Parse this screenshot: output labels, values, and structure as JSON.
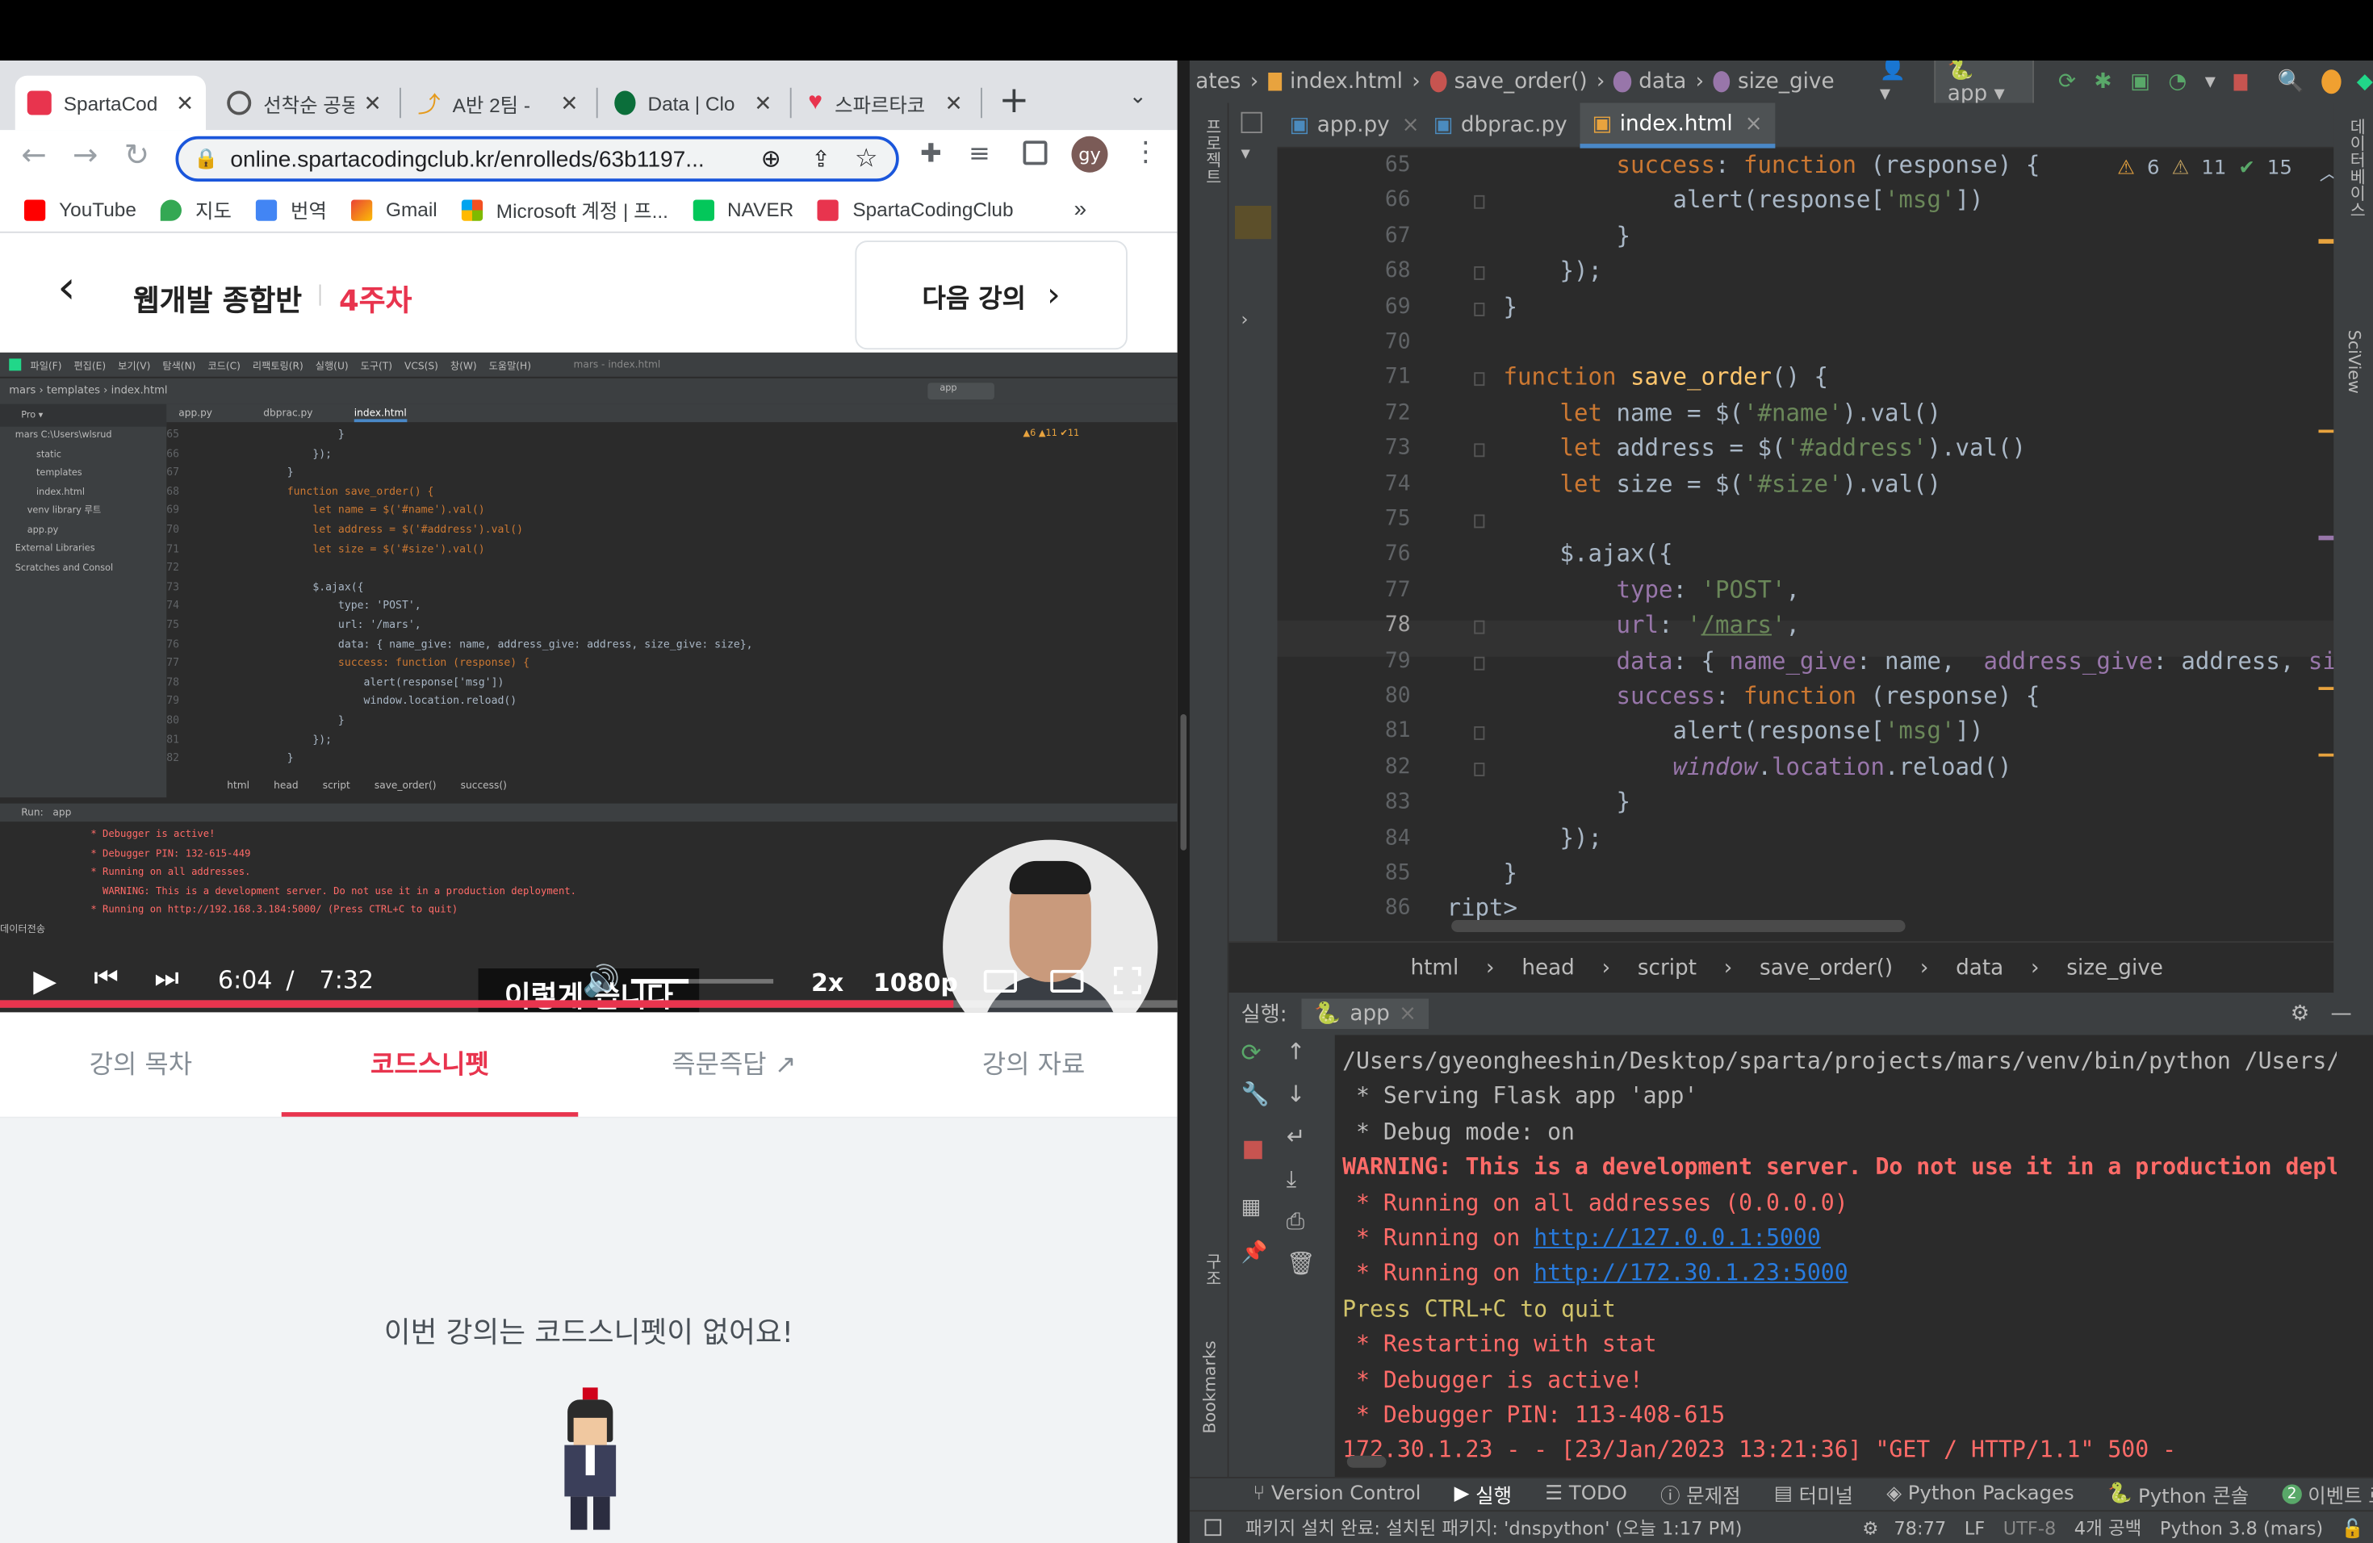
{
  "browser": {
    "tabs": [
      {
        "title": "SpartaCod",
        "active": true
      },
      {
        "title": "선착순 공동"
      },
      {
        "title": "A반 2팀 - "
      },
      {
        "title": "Data | Clo"
      },
      {
        "title": "스파르타코"
      }
    ],
    "new_tab": "+",
    "url": "online.spartacodingclub.kr/enrolleds/63b1197...",
    "profile": "gy",
    "bookmarks": [
      "YouTube",
      "지도",
      "번역",
      "Gmail",
      "Microsoft 계정 | 프...",
      "NAVER",
      "SpartaCodingClub"
    ],
    "bookmarks_more": "»"
  },
  "page": {
    "course": "웹개발 종합반",
    "week": "4주차",
    "next": "다음 강의",
    "tabs": [
      "강의 목차",
      "코드스니펫",
      "즉문즉답",
      "강의 자료"
    ],
    "empty": "이번 강의는 코드스니펫이 없어요!"
  },
  "video": {
    "time": "6:04",
    "sep": "/",
    "duration": "7:32",
    "speed": "2x",
    "quality": "1080p",
    "progress": 0.81,
    "volume": 0.4,
    "caption": "이렇게 씁니다",
    "mini_ide": {
      "menu": [
        "파일(F)",
        "편집(E)",
        "보기(V)",
        "탐색(N)",
        "코드(C)",
        "리팩토링(R)",
        "실행(U)",
        "도구(T)",
        "VCS(S)",
        "창(W)",
        "도움말(H)"
      ],
      "title": "mars - index.html",
      "crumb": [
        "mars",
        "templates",
        "index.html"
      ],
      "tabs": [
        "app.py",
        "dbprac.py",
        "index.html"
      ],
      "tree": [
        "mars C:\\Users\\wlsrud",
        "static",
        "templates",
        "index.html",
        "venv library 루트",
        "app.py",
        "External Libraries",
        "Scratches and Consol"
      ],
      "lines": [
        {
          "n": "65",
          "t": "                }"
        },
        {
          "n": "66",
          "t": "            });"
        },
        {
          "n": "67",
          "t": "        }"
        },
        {
          "n": "68",
          "t": "        function save_order() {"
        },
        {
          "n": "69",
          "t": "            let name = $('#name').val()"
        },
        {
          "n": "70",
          "t": "            let address = $('#address').val()"
        },
        {
          "n": "71",
          "t": "            let size = $('#size').val()"
        },
        {
          "n": "72",
          "t": ""
        },
        {
          "n": "73",
          "t": "            $.ajax({"
        },
        {
          "n": "74",
          "t": "                type: 'POST',"
        },
        {
          "n": "75",
          "t": "                url: '/mars',"
        },
        {
          "n": "76",
          "t": "                data: { name_give: name, address_give: address, size_give: size},"
        },
        {
          "n": "77",
          "t": "                success: function (response) {"
        },
        {
          "n": "78",
          "t": "                    alert(response['msg'])"
        },
        {
          "n": "79",
          "t": "                    window.location.reload()"
        },
        {
          "n": "80",
          "t": "                }"
        },
        {
          "n": "81",
          "t": "            });"
        },
        {
          "n": "82",
          "t": "        }"
        }
      ],
      "breadcrumb": [
        "html",
        "head",
        "script",
        "save_order()",
        "success()"
      ],
      "run_label": "Run:",
      "run_app": "app",
      "run_lines": [
        " * Debugger is active!",
        " * Debugger PIN: 132-615-449",
        " * Running on all addresses.",
        "   WARNING: This is a development server. Do not use it in a production deployment.",
        " * Running on http://192.168.3.184:5000/ (Press CTRL+C to quit)",
        "데이터전송"
      ],
      "inspections": "▲6 ▲11 ✔11"
    }
  },
  "ide": {
    "breadcrumb_top": [
      "ates",
      "index.html",
      "save_order()",
      "data",
      "size_give"
    ],
    "run_config": "app",
    "tabs": [
      "app.py",
      "dbprac.py",
      "index.html"
    ],
    "inspections": {
      "warn1": "6",
      "warn2": "11",
      "ok": "15"
    },
    "code": [
      {
        "n": "65",
        "h": "            <span class='kw'>success</span>: <span class='kw'>function</span> (response) {"
      },
      {
        "n": "66",
        "h": "                alert(response[<span class='str'>'msg'</span>])"
      },
      {
        "n": "67",
        "h": "            }"
      },
      {
        "n": "68",
        "h": "        });"
      },
      {
        "n": "69",
        "h": "    }"
      },
      {
        "n": "70",
        "h": ""
      },
      {
        "n": "71",
        "h": "    <span class='kw'>function</span> <span class='fn'>save_order</span>() {"
      },
      {
        "n": "72",
        "h": "        <span class='kw'>let</span> name = $(<span class='str'>'#name'</span>).val()"
      },
      {
        "n": "73",
        "h": "        <span class='kw'>let</span> address = $(<span class='str'>'#address'</span>).val()"
      },
      {
        "n": "74",
        "h": "        <span class='kw'>let</span> size = $(<span class='str'>'#size'</span>).val()"
      },
      {
        "n": "75",
        "h": ""
      },
      {
        "n": "76",
        "h": "        $.ajax({"
      },
      {
        "n": "77",
        "h": "            <span class='prop'>type</span>: <span class='str'>'POST'</span>,"
      },
      {
        "n": "78",
        "h": "            <span class='prop'>url</span>: <span class='str'>'<u>/mars</u>'</span>,"
      },
      {
        "n": "79",
        "h": "            <span class='prop'>data</span>: { <span class='prop'>name_give</span>: name,  <span class='prop'>address_give</span>: address, <span class='prop'>size_give</span>: size},"
      },
      {
        "n": "80",
        "h": "            <span class='prop'>success</span>: <span class='kw'>function</span> (response) {"
      },
      {
        "n": "81",
        "h": "                alert(response[<span class='str'>'msg'</span>])"
      },
      {
        "n": "82",
        "h": "                <span class='prop it'>window</span>.<span class='prop'>location</span>.reload()"
      },
      {
        "n": "83",
        "h": "            }"
      },
      {
        "n": "84",
        "h": "        });"
      },
      {
        "n": "85",
        "h": "    }"
      },
      {
        "n": "86",
        "h": "ript>"
      }
    ],
    "editor_breadcrumb": [
      "html",
      "head",
      "script",
      "save_order()",
      "data",
      "size_give"
    ],
    "run_label": "실행:",
    "run_app": "app",
    "run_lines": [
      {
        "c": "gray",
        "t": "/Users/gyeongheeshin/Desktop/sparta/projects/mars/venv/bin/python /Users/gyeo"
      },
      {
        "c": "gray",
        "t": " * Serving Flask app 'app'"
      },
      {
        "c": "gray",
        "t": " * Debug mode: on"
      },
      {
        "c": "red bold",
        "t": "WARNING: This is a development server. Do not use it in a production deploymen"
      },
      {
        "c": "red",
        "t": " * Running on all addresses (0.0.0.0)"
      },
      {
        "c": "red",
        "t": " * Running on ",
        "link": "http://127.0.0.1:5000"
      },
      {
        "c": "red",
        "t": " * Running on ",
        "link": "http://172.30.1.23:5000"
      },
      {
        "c": "yel",
        "t": "Press CTRL+C to quit"
      },
      {
        "c": "red",
        "t": " * Restarting with stat"
      },
      {
        "c": "red",
        "t": " * Debugger is active!"
      },
      {
        "c": "red",
        "t": " * Debugger PIN: 113-408-615"
      },
      {
        "c": "red",
        "t": "172.30.1.23 - - [23/Jan/2023 13:21:36] \"GET / HTTP/1.1\" 500 -"
      }
    ],
    "bottom_tools": [
      "Version Control",
      "실행",
      "TODO",
      "문제점",
      "터미널",
      "Python Packages",
      "Python 콘솔",
      "이벤트 로그"
    ],
    "event_count": "2",
    "status_msg": "패키지 설치 완료: 설치된 패키지: 'dnspython' (오늘 1:17 PM)",
    "status_right": [
      "78:77",
      "LF",
      "UTF-8",
      "4개 공백",
      "Python 3.8 (mars)"
    ],
    "left_stripe": [
      "프로젝트",
      "구조",
      "Bookmarks"
    ],
    "right_stripe": [
      "데이터베이스",
      "SciView"
    ]
  }
}
